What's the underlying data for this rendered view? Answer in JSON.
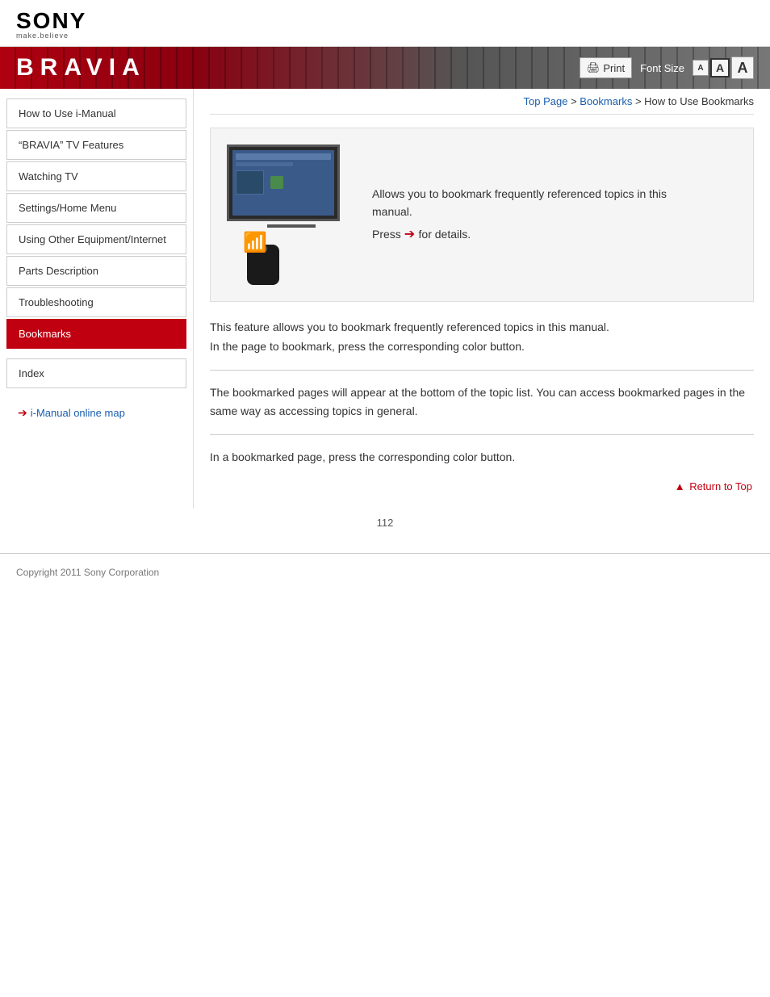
{
  "header": {
    "sony_text": "SONY",
    "tagline": "make.believe",
    "bravia_title": "BRAVIA"
  },
  "banner_controls": {
    "print_label": "Print",
    "font_size_label": "Font Size",
    "font_small": "A",
    "font_medium": "A",
    "font_large": "A"
  },
  "breadcrumb": {
    "top_page": "Top Page",
    "bookmarks": "Bookmarks",
    "current": "How to Use Bookmarks",
    "separator": " > "
  },
  "sidebar": {
    "items": [
      {
        "label": "How to Use i-Manual",
        "active": false
      },
      {
        "label": "“BRAVIA” TV Features",
        "active": false
      },
      {
        "label": "Watching TV",
        "active": false
      },
      {
        "label": "Settings/Home Menu",
        "active": false
      },
      {
        "label": "Using Other Equipment/Internet",
        "active": false
      },
      {
        "label": "Parts Description",
        "active": false
      },
      {
        "label": "Troubleshooting",
        "active": false
      },
      {
        "label": "Bookmarks",
        "active": true
      }
    ],
    "index_label": "Index",
    "online_map_label": "i-Manual online map"
  },
  "feature_box": {
    "description_line1": "Allows you to bookmark frequently referenced topics in this",
    "description_line2": "manual.",
    "press_text": "Press",
    "press_suffix": "for details."
  },
  "content": {
    "para1": "This feature allows you to bookmark frequently referenced topics in this manual.",
    "para2": "In the page to bookmark, press the corresponding color button.",
    "para3": "The bookmarked pages will appear at the bottom of the topic list. You can access bookmarked pages in the same way as accessing topics in general.",
    "para4": "In a bookmarked page, press the corresponding color button."
  },
  "return_top": {
    "label": "Return to Top"
  },
  "footer": {
    "copyright": "Copyright 2011 Sony Corporation",
    "page_number": "112"
  }
}
